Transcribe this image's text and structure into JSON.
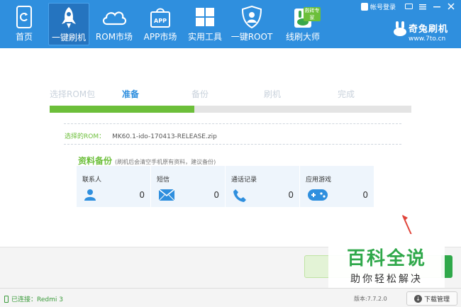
{
  "nav": [
    {
      "label": "首页",
      "icon": "refresh-phone-icon"
    },
    {
      "label": "一键刷机",
      "icon": "rocket-icon",
      "active": true
    },
    {
      "label": "ROM市场",
      "icon": "cloud-icon"
    },
    {
      "label": "APP市场",
      "icon": "shopping-bag-icon",
      "icon_text": "APP"
    },
    {
      "label": "实用工具",
      "icon": "grid-icon"
    },
    {
      "label": "一键ROOT",
      "icon": "shield-icon"
    },
    {
      "label": "线刷大师",
      "icon": "rabbit-icon",
      "badge": "救砖专家"
    }
  ],
  "header": {
    "login_label": "帐号登录",
    "brand_name": "奇兔刷机",
    "brand_url": "www.7to.cn"
  },
  "steps": {
    "items": [
      "选择ROM包",
      "准备",
      "备份",
      "刷机",
      "完成"
    ],
    "active_index": 1,
    "progress": 0.4
  },
  "rom": {
    "label": "选择的ROM：",
    "file": "MK60.1-ido-170413-RELEASE.zip"
  },
  "backup": {
    "title": "资料备份",
    "note": "(刷机后会清空手机原有资料，建议备份)",
    "items": [
      {
        "label": "联系人",
        "count": "0",
        "icon": "contact-icon"
      },
      {
        "label": "短信",
        "count": "0",
        "icon": "envelope-icon"
      },
      {
        "label": "通话记录",
        "count": "0",
        "icon": "phone-icon"
      },
      {
        "label": "应用游戏",
        "count": "0",
        "icon": "gamepad-icon"
      }
    ]
  },
  "watermark": {
    "title": "百科全说",
    "subtitle": "助你轻松解决"
  },
  "status": {
    "connection": "已连接：Redmi 3",
    "version": "版本:7.7.2.0",
    "download_label": "下载管理"
  },
  "colors": {
    "toolbar": "#2f8fde",
    "accent_green": "#6cbf3a",
    "active_step": "#2f8fde"
  }
}
